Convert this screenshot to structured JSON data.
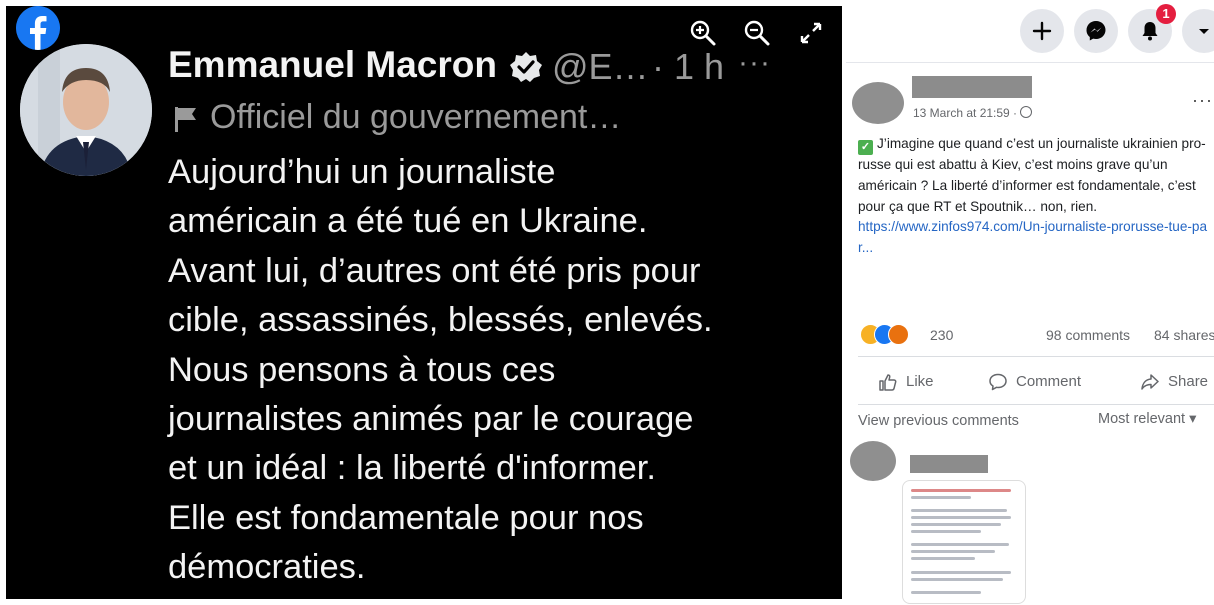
{
  "viewer": {
    "brand_icon": "facebook-logo-icon",
    "buttons": [
      "zoom-in-icon",
      "zoom-out-icon",
      "fullscreen-icon"
    ],
    "tweet": {
      "author_name": "Emmanuel Macron",
      "handle": "@E…",
      "time": "· 1 h",
      "more": "···",
      "label": "Officiel du gouvernement…",
      "text": "Aujourd’hui un journaliste\naméricain a été tué en Ukraine.\nAvant lui, d’autres ont été pris pour\ncible, assassinés, blessés, enlevés.\nNous pensons à tous ces\njournalistes animés par le courage\net un idéal : la liberté d'informer.\nElle est fondamentale pour nos\ndémocraties."
    }
  },
  "topbar": {
    "icons": [
      "plus-icon",
      "messenger-icon",
      "bell-icon",
      "caret-down-icon"
    ],
    "notification_count": "1"
  },
  "post": {
    "date": "13 March at 21:59 · ",
    "more": "···",
    "body": "J’imagine que quand c’est un journaliste ukrainien pro-russe qui est abattu à Kiev, c’est moins grave qu’un américain ? La liberté d’informer est fondamentale, c’est pour ça que RT et Spoutnik… non, rien.",
    "link": "https://www.zinfos974.com/Un-journaliste-prorusse-tue-par...",
    "reaction_count": "230",
    "comments_count": "98 comments",
    "shares_count": "84 shares",
    "actions": {
      "like": "Like",
      "comment": "Comment",
      "share": "Share"
    },
    "view_previous": "View previous comments",
    "sort": "Most relevant ▾"
  },
  "colors": {
    "facebook_blue": "#1877f2",
    "notification_red": "#e41e3f",
    "link": "#2566c4"
  }
}
